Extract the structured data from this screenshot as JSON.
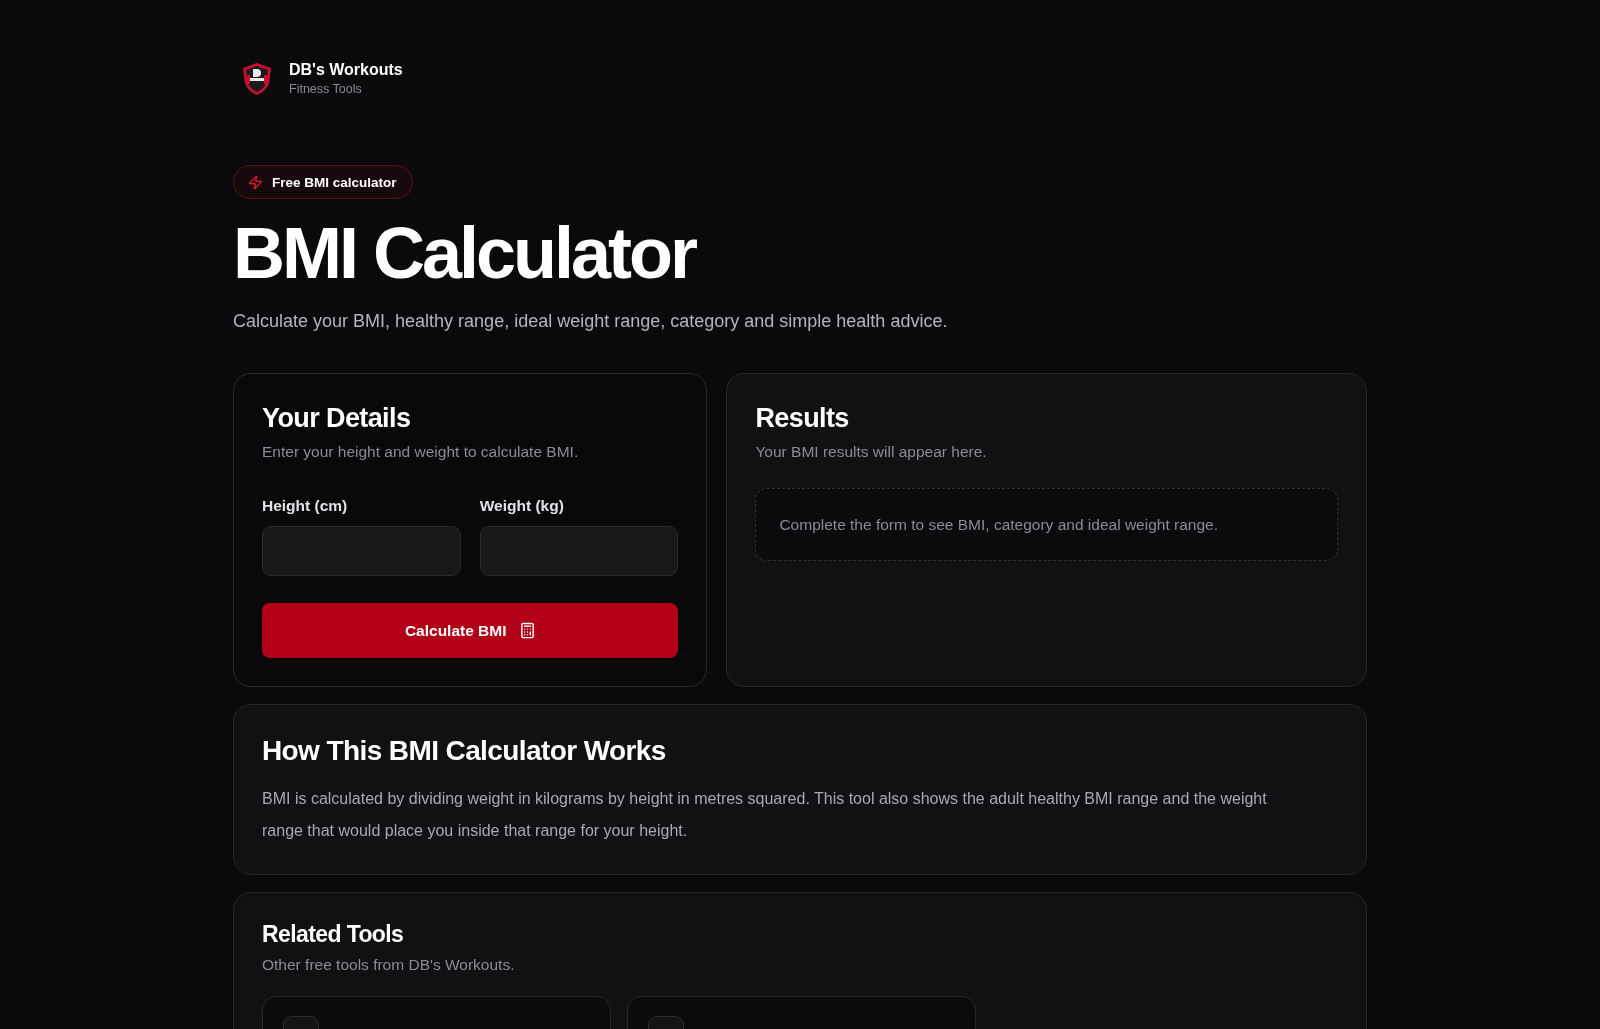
{
  "header": {
    "brand": "DB's Workouts",
    "tagline": "Fitness Tools"
  },
  "hero": {
    "badge": "Free BMI calculator",
    "title": "BMI Calculator",
    "subtitle": "Calculate your BMI, healthy range, ideal weight range, category and simple health advice."
  },
  "details_card": {
    "title": "Your Details",
    "subtitle": "Enter your height and weight to calculate BMI.",
    "fields": [
      {
        "label": "Height (cm)"
      },
      {
        "label": "Weight (kg)"
      }
    ],
    "button": "Calculate BMI"
  },
  "results_card": {
    "title": "Results",
    "subtitle": "Your BMI results will appear here.",
    "empty_message": "Complete the form to see BMI, category and ideal weight range."
  },
  "how_card": {
    "title": "How This BMI Calculator Works",
    "body": "BMI is calculated by dividing weight in kilograms by height in metres squared. This tool also shows the adult healthy BMI range and the weight range that would place you inside that range for your height."
  },
  "related_card": {
    "title": "Related Tools",
    "subtitle": "Other free tools from DB's Workouts."
  }
}
